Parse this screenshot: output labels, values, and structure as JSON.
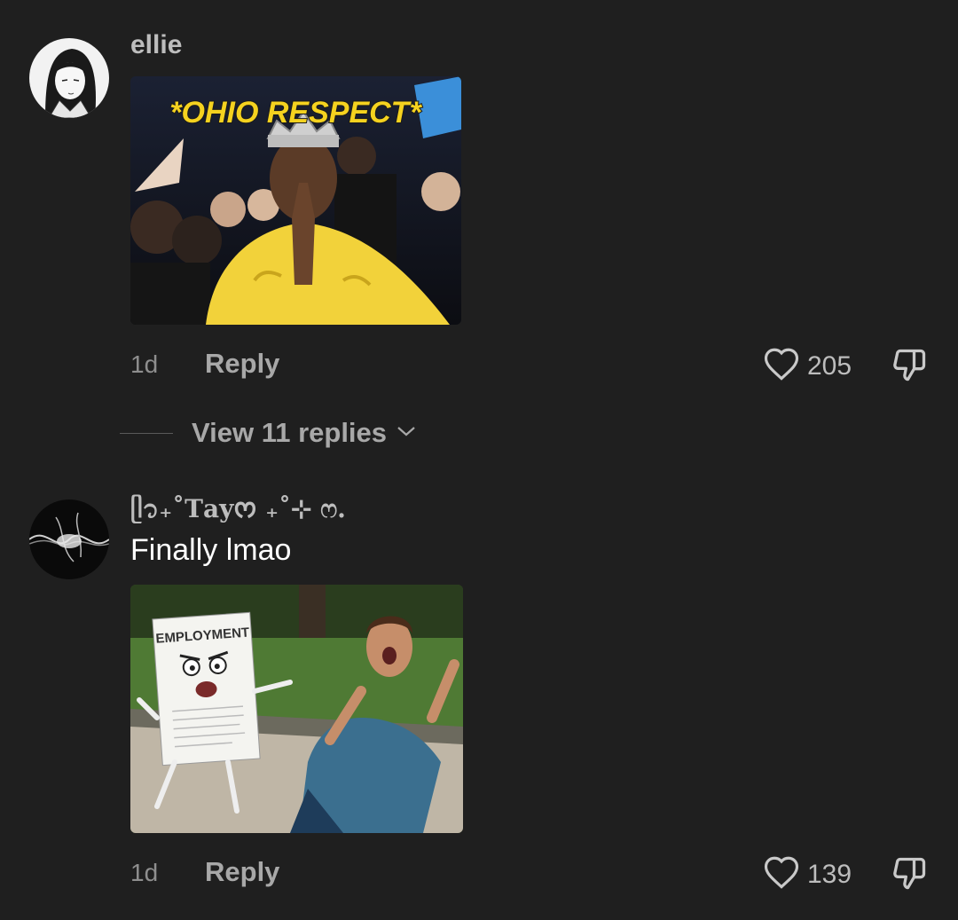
{
  "comments": [
    {
      "username": "ellie",
      "text": "",
      "media_caption": "*OHIO RESPECT*",
      "time": "1d",
      "reply_label": "Reply",
      "likes": "205"
    },
    {
      "username": "ᥫ᭡₊˚𝐓𝐚𝐲ᰔ ₊˚⊹ ෆ.",
      "text": "Finally lmao",
      "media_caption": "EMPLOYMENT",
      "time": "1d",
      "reply_label": "Reply",
      "likes": "139"
    }
  ],
  "view_replies_label": "View 11 replies",
  "icons": {
    "like": "heart-outline-icon",
    "dislike": "thumbs-down-outline-icon",
    "expand": "chevron-down-icon"
  },
  "colors": {
    "background": "#1f1f1f",
    "meme_yellow": "#f5d21f"
  }
}
